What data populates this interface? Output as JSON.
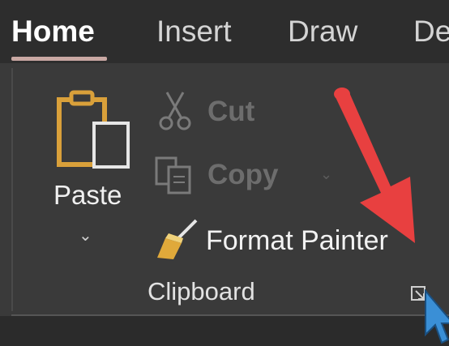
{
  "ribbon_tabs": [
    {
      "label": "Home",
      "active": true
    },
    {
      "label": "Insert",
      "active": false
    },
    {
      "label": "Draw",
      "active": false
    },
    {
      "label": "De",
      "active": false
    }
  ],
  "clipboard_group": {
    "paste_label": "Paste",
    "cut_label": "Cut",
    "copy_label": "Copy",
    "format_painter_label": "Format Painter",
    "group_label": "Clipboard",
    "cut_enabled": false,
    "copy_enabled": false
  },
  "icons": {
    "paste": "clipboard-icon",
    "cut": "scissors-icon",
    "copy": "copy-icon",
    "format_painter": "paintbrush-icon",
    "launcher": "dialog-launcher-icon",
    "annotation": "red-arrow-icon",
    "cursor": "mouse-pointer-icon"
  },
  "colors": {
    "accent_underline": "#c9a8a3",
    "arrow_red": "#e84040",
    "cursor_blue": "#3a8fd6"
  }
}
